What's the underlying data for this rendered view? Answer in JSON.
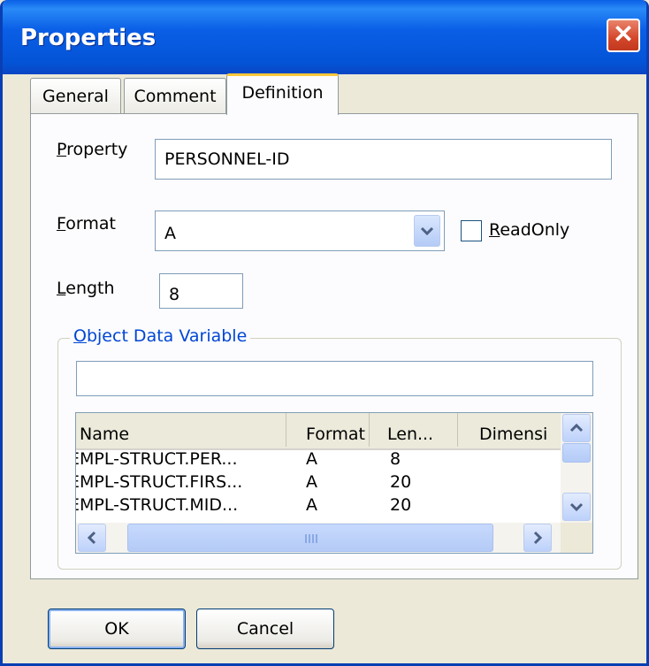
{
  "window": {
    "title": "Properties",
    "close_glyph": "✕"
  },
  "tabs": [
    {
      "label": "General",
      "active": false
    },
    {
      "label": "Comment",
      "active": false
    },
    {
      "label": "Definition",
      "active": true
    }
  ],
  "form": {
    "property": {
      "label_mnemonic": "P",
      "label_rest": "roperty",
      "value": "PERSONNEL-ID"
    },
    "format": {
      "label_mnemonic": "F",
      "label_rest": "ormat",
      "value": "A",
      "dropdown_icon": "chevron-down-icon"
    },
    "readonly": {
      "label_mnemonic": "R",
      "label_rest": "eadOnly",
      "checked": false
    },
    "length": {
      "label_mnemonic": "L",
      "label_rest": "ength",
      "value": "8"
    }
  },
  "object_data_variable": {
    "label_mnemonic": "O",
    "label_rest": "bject Data Variable",
    "value": "",
    "columns": [
      "Name",
      "Format",
      "Len...",
      "Dimensi"
    ],
    "rows": [
      {
        "name": "EMPL-STRUCT.PER...",
        "format": "A",
        "len": "8",
        "dimension": ""
      },
      {
        "name": "EMPL-STRUCT.FIRS...",
        "format": "A",
        "len": "20",
        "dimension": ""
      },
      {
        "name": "EMPL-STRUCT.MID...",
        "format": "A",
        "len": "20",
        "dimension": ""
      }
    ]
  },
  "buttons": {
    "ok": "OK",
    "cancel": "Cancel"
  },
  "colors": {
    "titlebar": "#0a5fe6",
    "close": "#d4462a",
    "groupbox_label": "#0046d5",
    "dialog_bg": "#ece9d8"
  }
}
